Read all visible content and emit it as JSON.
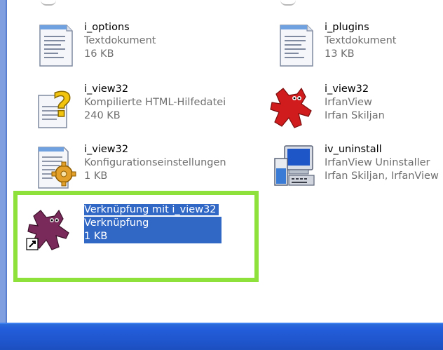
{
  "files": [
    {
      "name": "i_options",
      "type": "Textdokument",
      "info": "16 KB",
      "icon": "text-document-icon"
    },
    {
      "name": "i_plugins",
      "type": "Textdokument",
      "info": "13 KB",
      "icon": "text-document-icon"
    },
    {
      "name": "i_view32",
      "type": "Kompilierte HTML-Hilfedatei",
      "info": "240 KB",
      "icon": "help-file-icon"
    },
    {
      "name": "i_view32",
      "type": "IrfanView",
      "info": "Irfan Skiljan",
      "icon": "irfanview-cat-icon"
    },
    {
      "name": "i_view32",
      "type": "Konfigurationseinstellungen",
      "info": "1 KB",
      "icon": "config-settings-icon"
    },
    {
      "name": "iv_uninstall",
      "type": "IrfanView Uninstaller",
      "info": "Irfan Skiljan, IrfanView",
      "icon": "uninstaller-computer-icon"
    },
    {
      "name": "Verknüpfung mit i_view32",
      "type": "Verknüpfung",
      "info": "1 KB",
      "icon": "shortcut-cat-icon",
      "selected": true
    }
  ],
  "colors": {
    "selection": "#3168c6",
    "highlight_box": "#8ee03a",
    "taskbar": "#245edb",
    "secondary_text": "#6f6f6f"
  }
}
